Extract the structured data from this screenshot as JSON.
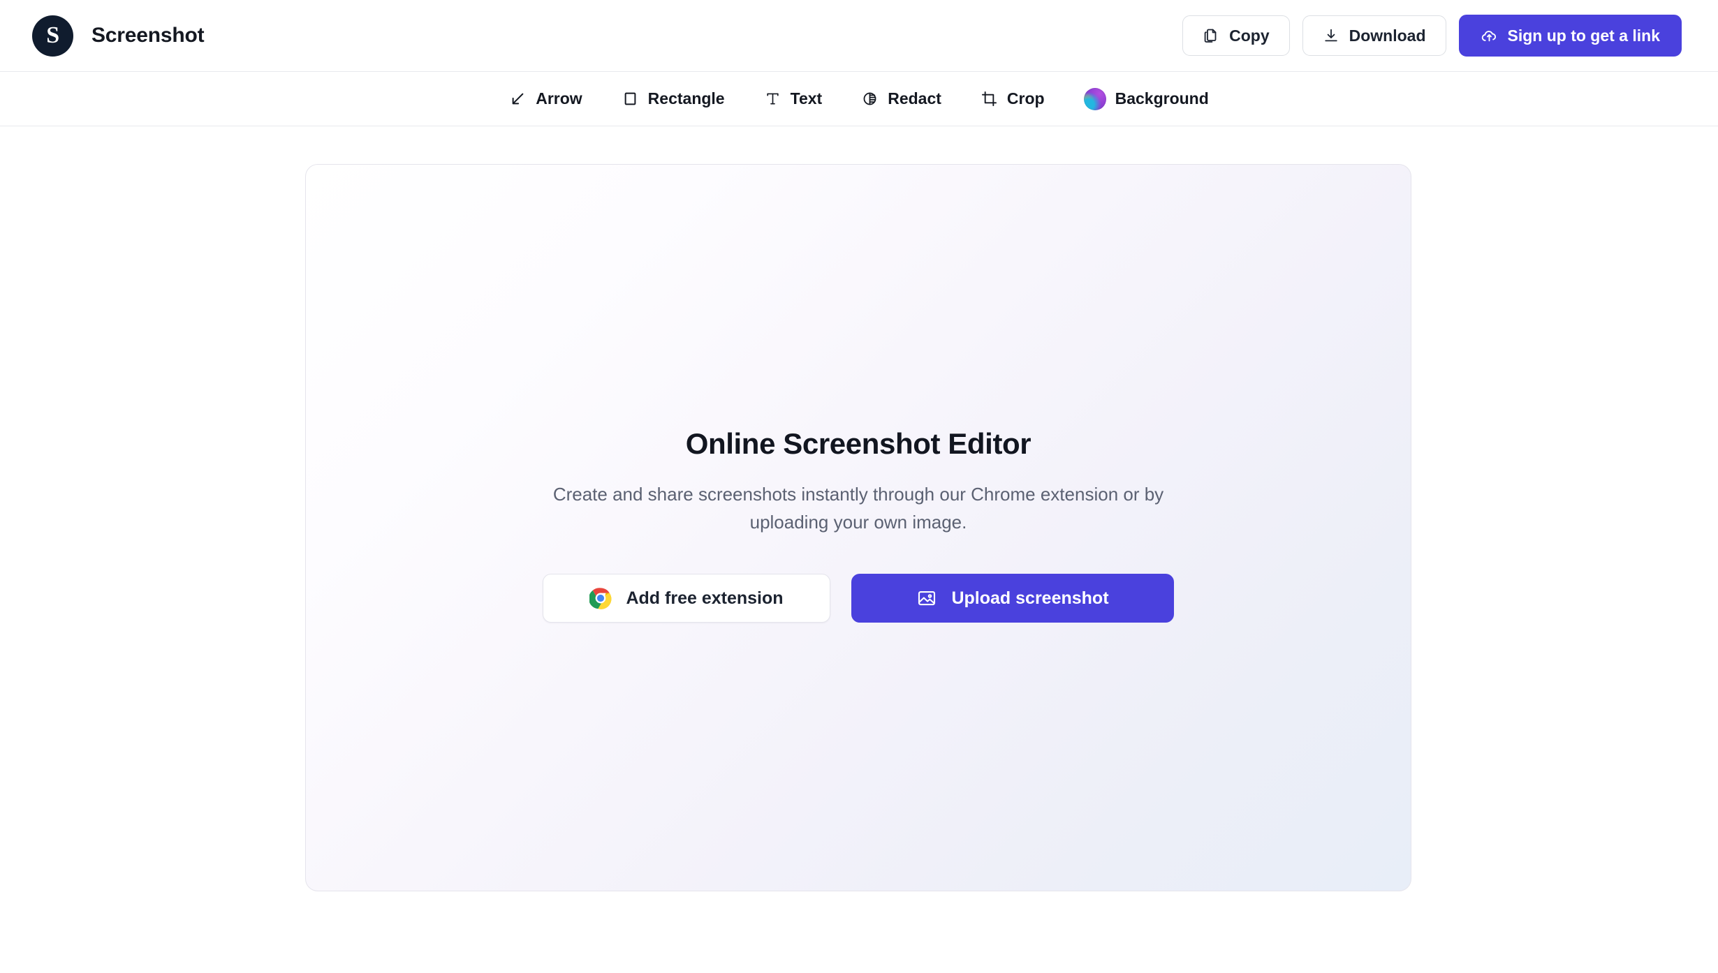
{
  "app": {
    "brand_letter": "S",
    "title": "Screenshot",
    "accent_color": "#4A41DD",
    "logo_bg_color": "#101C2E",
    "border_color": "#E8EAED"
  },
  "header": {
    "actions": [
      {
        "label": "Copy",
        "icon": "copy-icon",
        "style": "ghost"
      },
      {
        "label": "Download",
        "icon": "download-icon",
        "style": "ghost"
      },
      {
        "label": "Sign up to get a link",
        "icon": "cloud-upload-icon",
        "style": "primary"
      }
    ]
  },
  "toolbar": {
    "tools": [
      {
        "label": "Arrow",
        "icon": "arrow-down-left-icon"
      },
      {
        "label": "Rectangle",
        "icon": "rectangle-icon"
      },
      {
        "label": "Text",
        "icon": "text-icon"
      },
      {
        "label": "Redact",
        "icon": "redact-icon"
      },
      {
        "label": "Crop",
        "icon": "crop-icon"
      },
      {
        "label": "Background",
        "icon": "background-gradient-icon"
      }
    ]
  },
  "canvas": {
    "empty_state": {
      "title": "Online Screenshot Editor",
      "description": "Create and share screenshots instantly through our Chrome extension or by uploading your own image.",
      "primary_action": {
        "label": "Upload screenshot",
        "icon": "image-icon"
      },
      "secondary_action": {
        "label": "Add free extension",
        "icon": "chrome-icon"
      }
    }
  }
}
